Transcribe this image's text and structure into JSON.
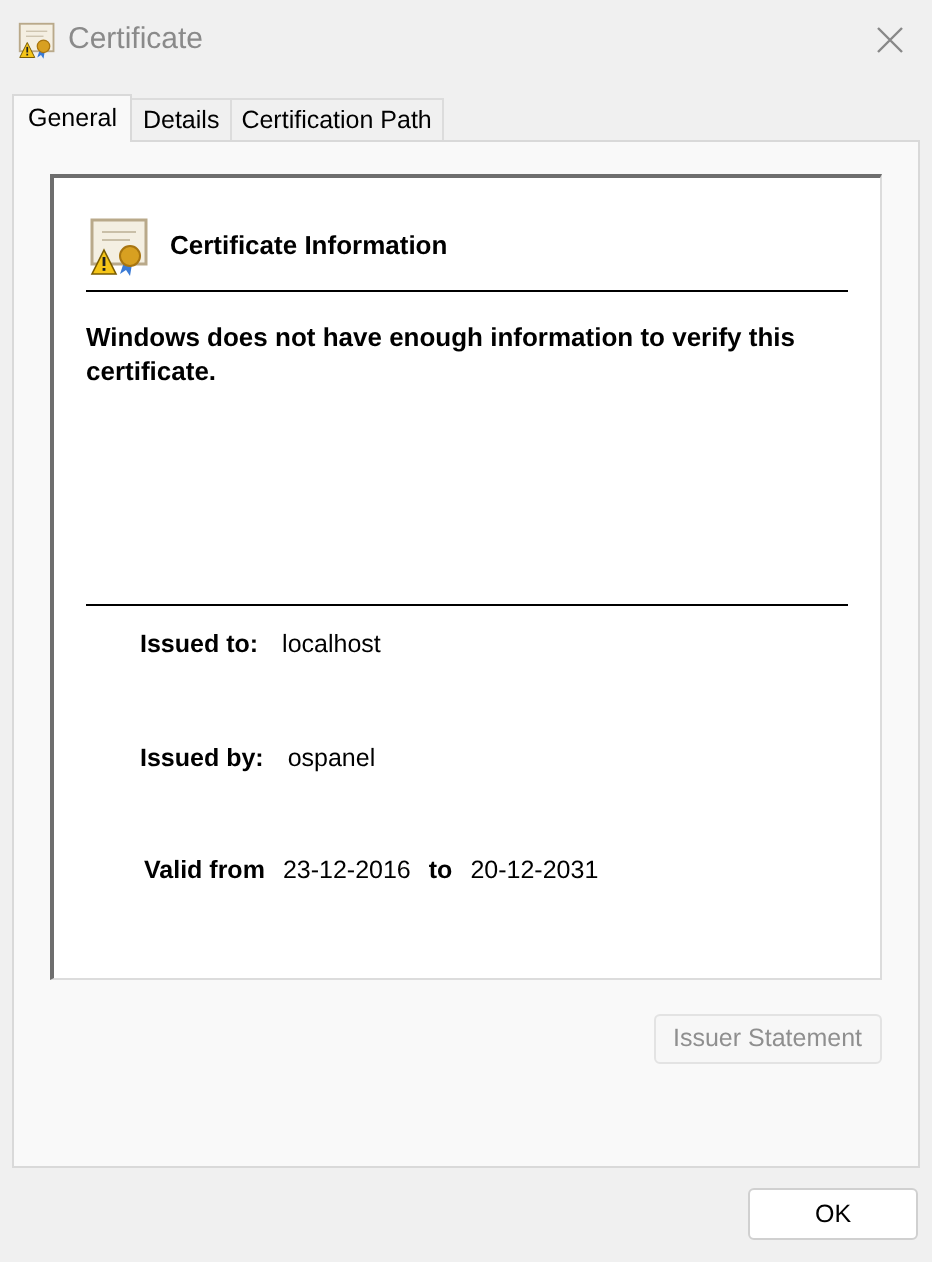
{
  "window": {
    "title": "Certificate"
  },
  "tabs": [
    {
      "label": "General",
      "selected": true
    },
    {
      "label": "Details",
      "selected": false
    },
    {
      "label": "Certification Path",
      "selected": false
    }
  ],
  "info": {
    "heading": "Certificate Information",
    "message": "Windows does not have enough information to verify this certificate.",
    "issued_to": {
      "label": "Issued to:",
      "value": "localhost"
    },
    "issued_by": {
      "label": "Issued by:",
      "value": "ospanel"
    },
    "validity": {
      "label": "Valid from",
      "from": "23-12-2016",
      "to_label": "to",
      "to": "20-12-2031"
    }
  },
  "issuer_statement_button": {
    "label": "Issuer Statement",
    "disabled": true
  },
  "ok_button": {
    "label": "OK"
  }
}
